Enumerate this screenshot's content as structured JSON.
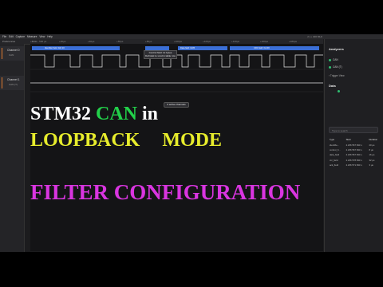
{
  "menu": {
    "items": [
      "File",
      "Edit",
      "Capture",
      "Measure",
      "View",
      "Help"
    ],
    "status": "2 s  • 400 MHz"
  },
  "toolbar": {
    "label": "Preferences",
    "time": "1 ms - 500 µs"
  },
  "ruler": {
    "ticks": [
      "+0ms",
      "+20µs",
      "+40µs",
      "+60µs",
      "+80µs",
      "+100µs",
      "+120µs",
      "+140µs",
      "+160µs",
      "+180µs"
    ]
  },
  "channels": [
    {
      "name": "Channel 0",
      "sub": "CAN"
    },
    {
      "name": "Channel 1",
      "sub": "CAN (T)"
    }
  ],
  "decode_frames": [
    "Identifier field: 0x0 10",
    "Control field: 2 bytes",
    "Data field: 0x05",
    "CRC field: 0x1F0"
  ],
  "tooltip": {
    "line1": "Control field: 2x bytes",
    "line2": "Defmdel to xxxd in table row"
  },
  "popup": "0 active channels",
  "overlay": {
    "line1_part1": "STM32",
    "line1_part2": "CAN",
    "line1_part3": "in",
    "line2_part1": "LOOPBACK",
    "line2_part2": "MODE",
    "line3": "FILTER CONFIGURATION"
  },
  "analyzers": {
    "title": "Analyzers",
    "items": [
      "CAN",
      "CAN (T)"
    ],
    "trigger": "Trigger View"
  },
  "data_panel": {
    "title": "Data",
    "search_placeholder": "Type to search",
    "columns": [
      "Type",
      "Start",
      "Duration"
    ],
    "rows": [
      [
        "identifie...",
        "2.236 567 993 s",
        "20 µs"
      ],
      [
        "control_fi...",
        "2.236 567 993 s",
        "8 µs"
      ],
      [
        "data_field",
        "2.236 567 993 s",
        "16 µs"
      ],
      [
        "crc_field",
        "2.236 578 993 s",
        "32 µs"
      ],
      [
        "ack_field",
        "2.236 571 993 s",
        "3 µs"
      ]
    ]
  },
  "colors": {
    "accent": "#e07a30",
    "frame_blue": "#3b6fd6",
    "green": "#2fbf71",
    "overlay_yellow": "#e7ec2c",
    "overlay_magenta": "#d935e0",
    "can_green": "#22d14a"
  }
}
